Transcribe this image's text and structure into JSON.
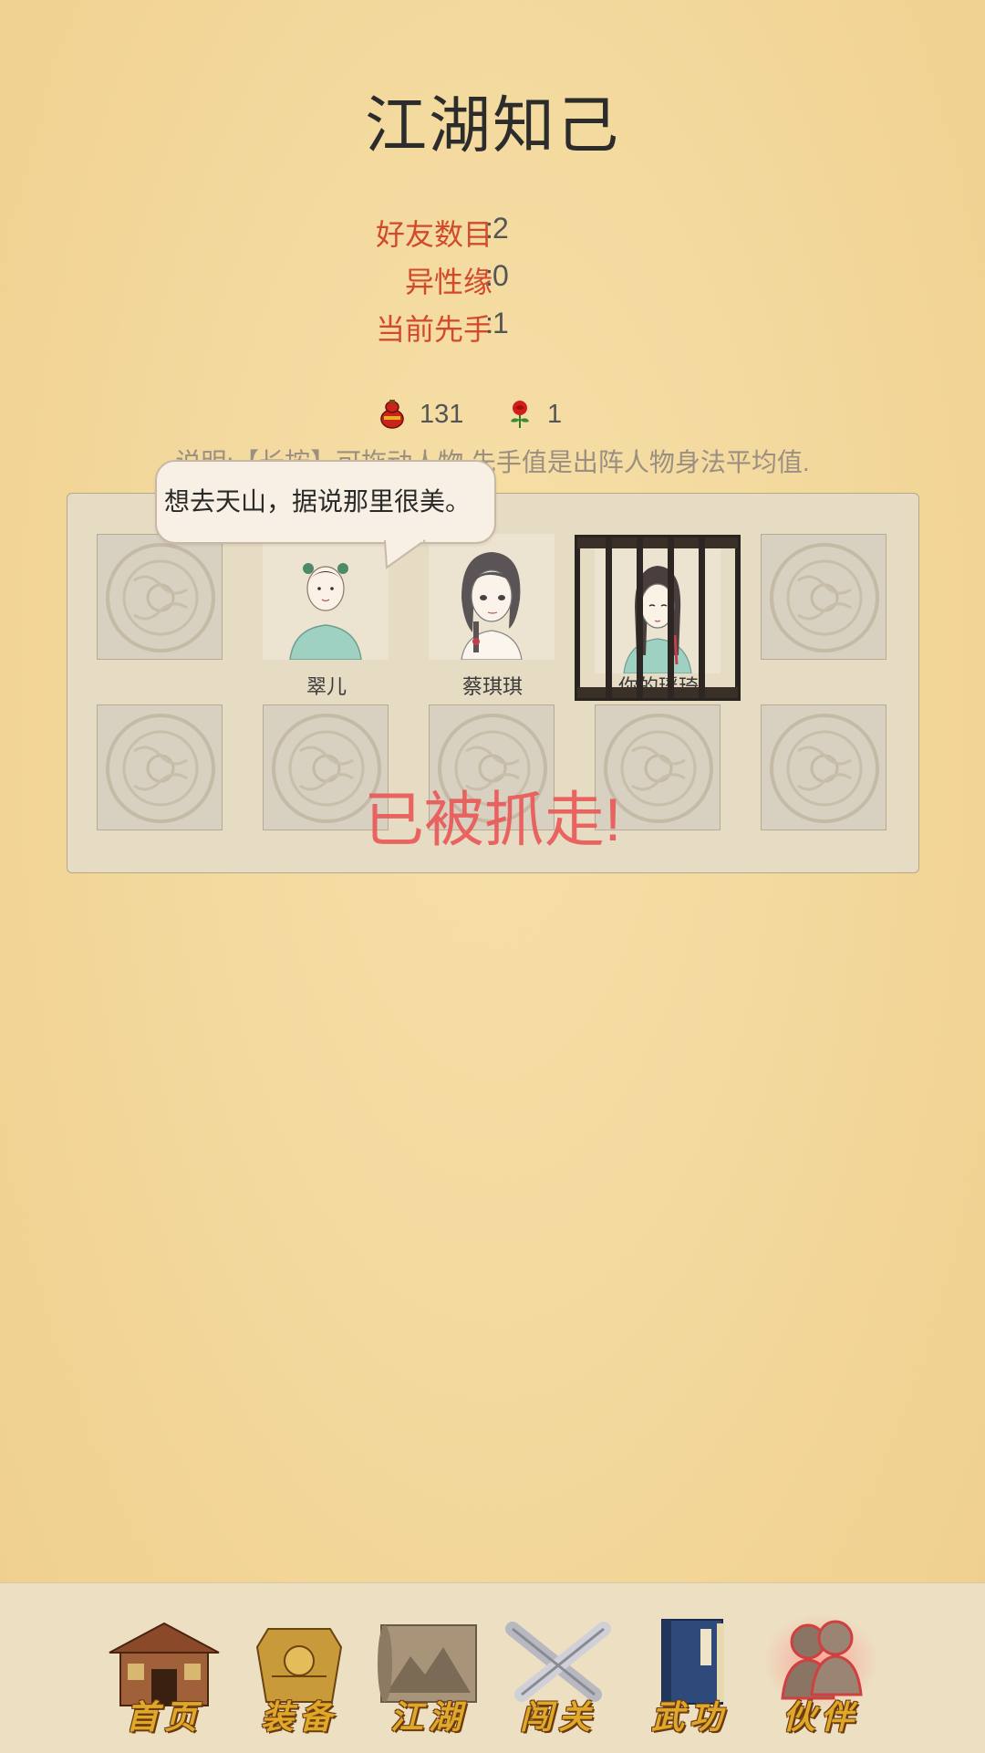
{
  "title": "江湖知己",
  "stats": [
    {
      "label": "好友数目",
      "value": "2"
    },
    {
      "label": "异性缘",
      "value": "0"
    },
    {
      "label": "当前先手",
      "value": "1"
    }
  ],
  "colon": ":",
  "currency": {
    "gourd_icon": "gourd-icon",
    "gourd_value": "131",
    "rose_icon": "rose-icon",
    "rose_value": "1"
  },
  "note": "说明:【长按】可拖动人物,先手值是出阵人物身法平均值.",
  "speech_bubble": "想去天山，据说那里很美。",
  "characters": [
    {
      "name": "翠儿",
      "captured": false
    },
    {
      "name": "蔡琪琪",
      "captured": false
    },
    {
      "name": "你的瑶琦",
      "captured": true
    }
  ],
  "captured_text": "已被抓走!",
  "nav": [
    {
      "label": "首页",
      "icon": "house-icon"
    },
    {
      "label": "装备",
      "icon": "armor-icon"
    },
    {
      "label": "江湖",
      "icon": "scroll-map-icon"
    },
    {
      "label": "闯关",
      "icon": "crossed-swords-icon"
    },
    {
      "label": "武功",
      "icon": "book-icon"
    },
    {
      "label": "伙伴",
      "icon": "partners-icon",
      "active": true
    }
  ],
  "colors": {
    "accent_red": "#d24a2c",
    "captured_red": "#ea5a58",
    "nav_gold": "#e0a828"
  }
}
